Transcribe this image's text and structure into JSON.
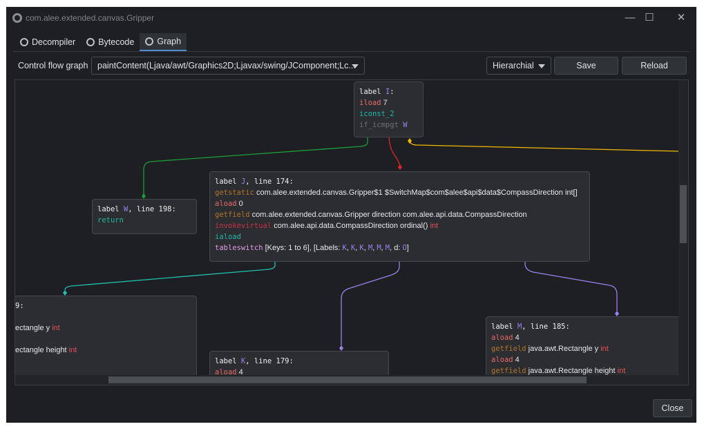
{
  "window": {
    "title": "com.alee.extended.canvas.Gripper",
    "controls": [
      "minimize",
      "maximize",
      "close"
    ]
  },
  "tabs": [
    {
      "label": "Decompiler",
      "icon": "decompiler-icon"
    },
    {
      "label": "Bytecode",
      "icon": "bytecode-icon"
    },
    {
      "label": "Graph",
      "icon": "graph-icon",
      "active": true
    }
  ],
  "toolbar": {
    "label": "Control flow graph",
    "method": "paintContent(Ljava/awt/Graphics2D;Ljavax/swing/JComponent;Lc...",
    "layout": "Hierarchial",
    "save": "Save",
    "reload": "Reload"
  },
  "colors": {
    "bg": "#1e1f22",
    "node": "#2b2d30",
    "edge_true": "#1a9e3a",
    "edge_false": "#e0262b",
    "edge_default": "#f2b705",
    "edge_switch": "#9d7ff0",
    "edge_teal": "#1fc1b3"
  },
  "nodes": {
    "I": [
      [
        [
          "label ",
          "kw"
        ],
        [
          "I",
          "label"
        ],
        [
          ":",
          "kw"
        ]
      ],
      [
        [
          "iload",
          "load"
        ],
        [
          " 7",
          "txt"
        ]
      ],
      [
        [
          "iconst_2",
          "const"
        ]
      ],
      [
        [
          "if_icmpgt",
          "jmp"
        ],
        [
          " W",
          "label"
        ]
      ]
    ],
    "W": [
      [
        [
          "label ",
          "kw"
        ],
        [
          "W",
          "label"
        ],
        [
          ", line 198:",
          "kw"
        ]
      ],
      [
        [
          "return",
          "const"
        ]
      ]
    ],
    "J": [
      [
        [
          "label ",
          "kw"
        ],
        [
          "J",
          "label"
        ],
        [
          ", line 174:",
          "kw"
        ]
      ],
      [
        [
          "getstatic",
          "field"
        ],
        [
          " com.alee.extended.canvas.Gripper$1 $SwitchMap$com$alee$api$data$CompassDirection int[]",
          "txt"
        ]
      ],
      [
        [
          "aload",
          "load"
        ],
        [
          " 0",
          "txt"
        ]
      ],
      [
        [
          "getfield",
          "field"
        ],
        [
          " com.alee.extended.canvas.Gripper direction com.alee.api.data.CompassDirection",
          "txt"
        ]
      ],
      [
        [
          "invokevirtual",
          "inv"
        ],
        [
          " com.alee.api.data.CompassDirection ordinal() ",
          "txt"
        ],
        [
          "int",
          "int"
        ]
      ],
      [
        [
          "iaload",
          "const"
        ]
      ],
      [
        [
          "tableswitch",
          "sw"
        ],
        [
          " [Keys: 1 to 6], [Labels: ",
          "txt"
        ],
        [
          "K",
          "label"
        ],
        [
          ", ",
          "txt"
        ],
        [
          "K",
          "label"
        ],
        [
          ", ",
          "txt"
        ],
        [
          "K",
          "label"
        ],
        [
          ", ",
          "txt"
        ],
        [
          "M",
          "label"
        ],
        [
          ", ",
          "txt"
        ],
        [
          "M",
          "label"
        ],
        [
          ", ",
          "txt"
        ],
        [
          "M",
          "label"
        ],
        [
          ", d: ",
          "txt"
        ],
        [
          "O",
          "label"
        ],
        [
          "]",
          "txt"
        ]
      ]
    ],
    "L": [
      [
        [
          "9:",
          "kw"
        ]
      ],
      [],
      [
        [
          "ectangle y ",
          "txt"
        ],
        [
          "int",
          "int"
        ]
      ],
      [],
      [
        [
          "ectangle height ",
          "txt"
        ],
        [
          "int",
          "int"
        ]
      ]
    ],
    "K": [
      [
        [
          "label ",
          "kw"
        ],
        [
          "K",
          "label"
        ],
        [
          ", line 179:",
          "kw"
        ]
      ],
      [
        [
          "aload",
          "load"
        ],
        [
          " 4",
          "txt"
        ]
      ]
    ],
    "M": [
      [
        [
          "label ",
          "kw"
        ],
        [
          "M",
          "label"
        ],
        [
          ", line 185:",
          "kw"
        ]
      ],
      [
        [
          "aload",
          "load"
        ],
        [
          " 4",
          "txt"
        ]
      ],
      [
        [
          "getfield",
          "field"
        ],
        [
          " java.awt.Rectangle y ",
          "txt"
        ],
        [
          "int",
          "int"
        ]
      ],
      [
        [
          "aload",
          "load"
        ],
        [
          " 4",
          "txt"
        ]
      ],
      [
        [
          "getfield",
          "field"
        ],
        [
          " java.awt.Rectangle height ",
          "txt"
        ],
        [
          "int",
          "int"
        ]
      ]
    ]
  },
  "footer": {
    "close": "Close"
  }
}
